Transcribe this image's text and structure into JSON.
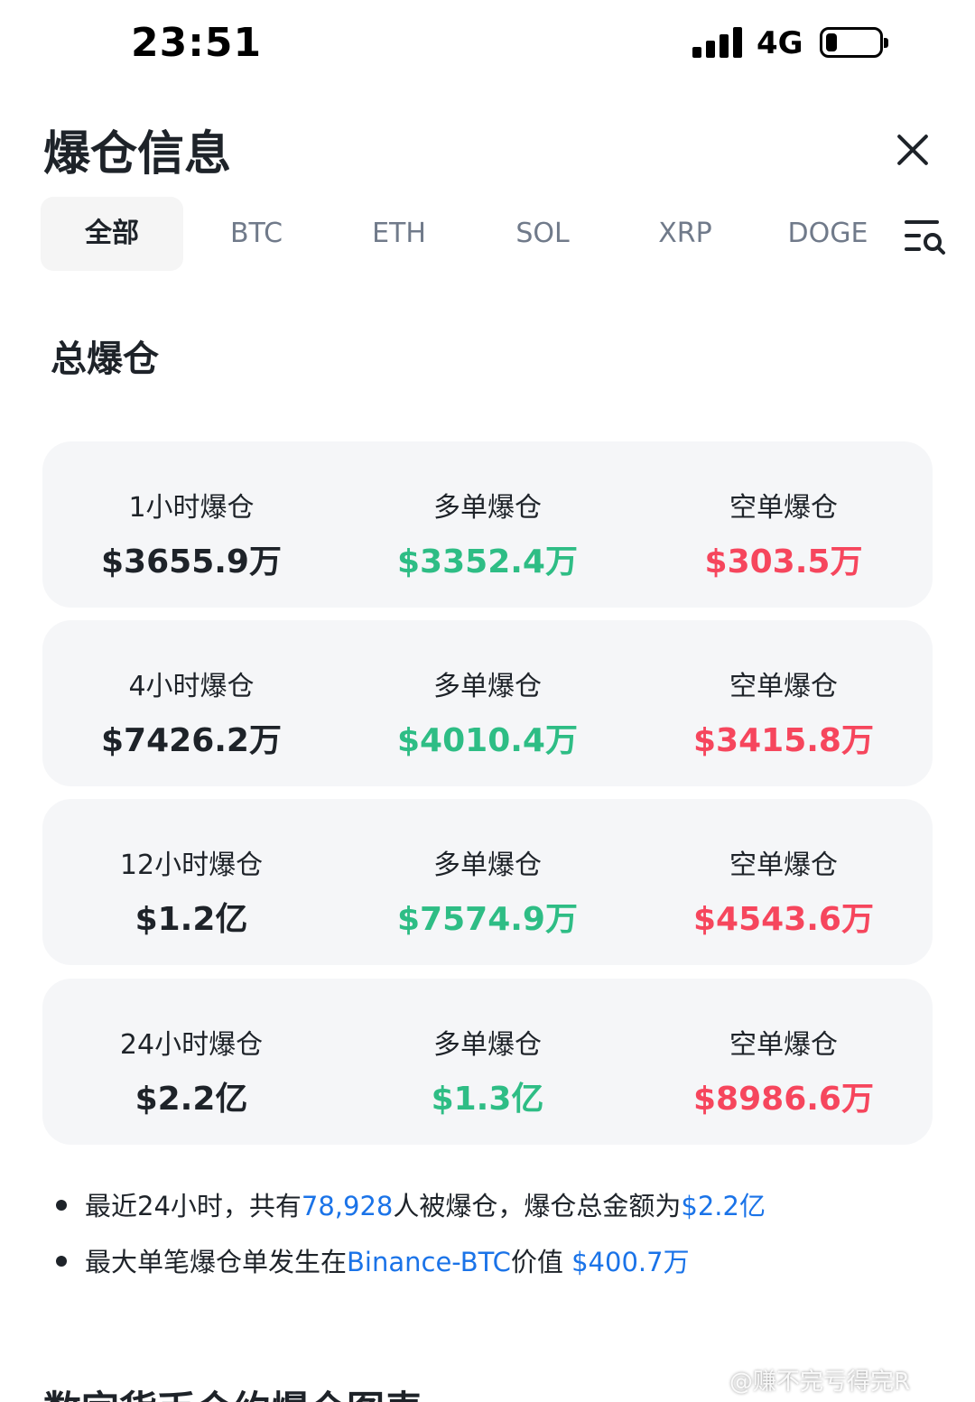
{
  "status_bar": {
    "time": "23:51",
    "network": "4G"
  },
  "header": {
    "title": "爆仓信息",
    "close_icon": "close-icon"
  },
  "tabs": [
    {
      "label": "全部",
      "active": true
    },
    {
      "label": "BTC",
      "active": false
    },
    {
      "label": "ETH",
      "active": false
    },
    {
      "label": "SOL",
      "active": false
    },
    {
      "label": "XRP",
      "active": false
    },
    {
      "label": "DOGE",
      "active": false
    }
  ],
  "section_title": "总爆仓",
  "colors": {
    "long": "#2ebd85",
    "short": "#f6465d",
    "link": "#1a73e8",
    "text": "#1e2329"
  },
  "cards": [
    {
      "period_label": "1小时爆仓",
      "total": "$3655.9万",
      "long_label": "多单爆仓",
      "long_value": "$3352.4万",
      "short_label": "空单爆仓",
      "short_value": "$303.5万"
    },
    {
      "period_label": "4小时爆仓",
      "total": "$7426.2万",
      "long_label": "多单爆仓",
      "long_value": "$4010.4万",
      "short_label": "空单爆仓",
      "short_value": "$3415.8万"
    },
    {
      "period_label": "12小时爆仓",
      "total": "$1.2亿",
      "long_label": "多单爆仓",
      "long_value": "$7574.9万",
      "short_label": "空单爆仓",
      "short_value": "$4543.6万"
    },
    {
      "period_label": "24小时爆仓",
      "total": "$2.2亿",
      "long_label": "多单爆仓",
      "long_value": "$1.3亿",
      "short_label": "空单爆仓",
      "short_value": "$8986.6万"
    }
  ],
  "notes": {
    "line1": {
      "prefix": "最近24小时，共有",
      "count": "78,928",
      "middle": "人被爆仓，爆仓总金额为",
      "amount": "$2.2亿"
    },
    "line2": {
      "prefix": "最大单笔爆仓单发生在",
      "exchange": "Binance-BTC",
      "middle": "价值 ",
      "amount": "$400.7万"
    }
  },
  "bottom_title": "数字货币合约爆仓图表",
  "watermark": "@赚不完亏得完R"
}
